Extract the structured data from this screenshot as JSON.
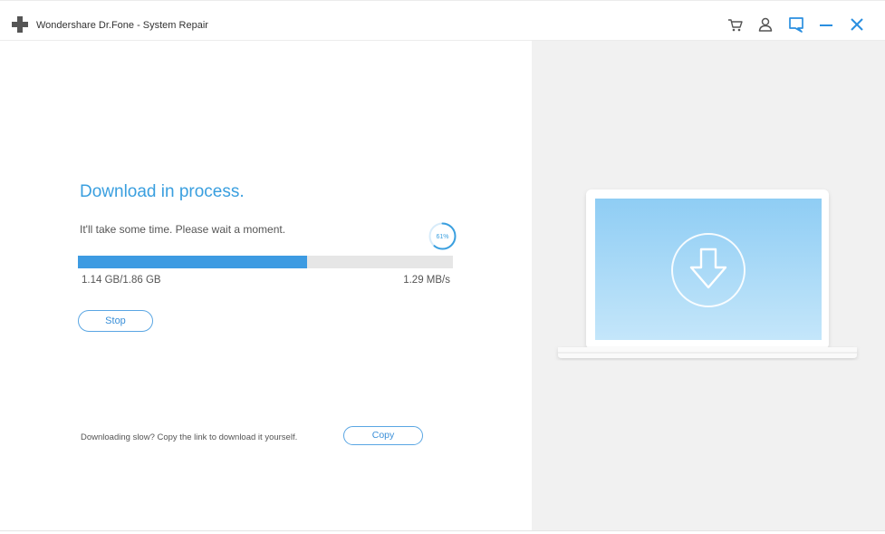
{
  "window": {
    "title": "Wondershare Dr.Fone - System Repair"
  },
  "titlebar_icons": [
    "cart-icon",
    "account-icon",
    "feedback-icon",
    "minimize-icon",
    "close-icon"
  ],
  "download": {
    "heading": "Download in process.",
    "subtext": "It'll take some time. Please wait a moment.",
    "progress_label": "61%",
    "progress_fraction": 0.61,
    "size_text": "1.14 GB/1.86 GB",
    "speed_text": "1.29 MB/s",
    "stop_label": "Stop"
  },
  "footer": {
    "slow_text": "Downloading slow? Copy the link to download it yourself.",
    "copy_label": "Copy"
  },
  "illustration": {
    "icon": "download-arrow-icon"
  },
  "colors": {
    "accent": "#3a9fdf",
    "progress_fill": "#3d9be2",
    "progress_track": "#e6e6e6",
    "right_pane_bg": "#f1f1f1",
    "screen_bg": "#a8d8f6"
  }
}
